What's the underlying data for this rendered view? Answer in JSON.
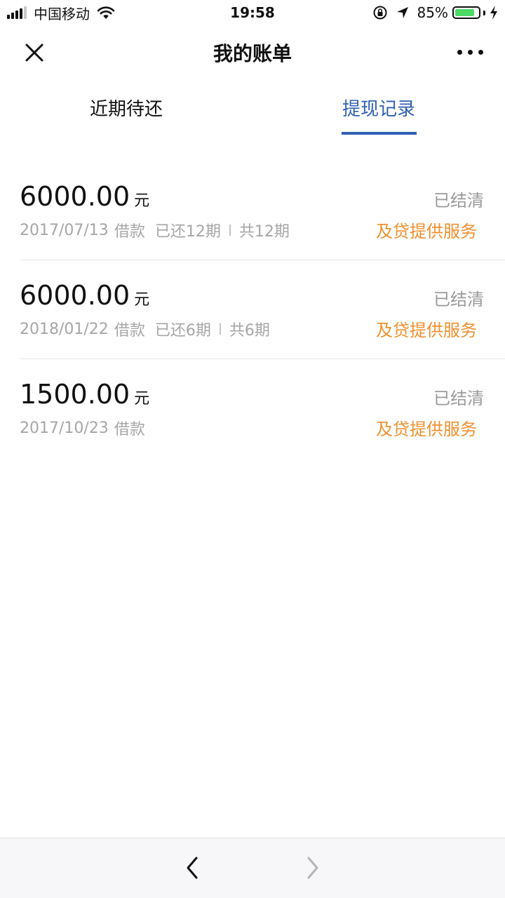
{
  "status_bar": {
    "carrier": "中国移动",
    "time": "19:58",
    "battery_percent": "85%",
    "battery_level": 0.85,
    "signal_bars": 4,
    "icons": [
      "signal-icon",
      "wifi-icon",
      "orientation-lock-icon",
      "location-arrow-icon",
      "battery-icon",
      "charging-bolt-icon"
    ]
  },
  "nav": {
    "title": "我的账单",
    "close_icon": "close-icon",
    "more_icon": "more-dots-icon"
  },
  "tabs": [
    {
      "label": "近期待还",
      "active": false
    },
    {
      "label": "提现记录",
      "active": true
    }
  ],
  "records": [
    {
      "amount": "6000.00",
      "unit": "元",
      "status": "已结清",
      "date": "2017/07/13",
      "type": "借款",
      "paid": "已还12期",
      "total": "共12期",
      "provider": "及贷提供服务"
    },
    {
      "amount": "6000.00",
      "unit": "元",
      "status": "已结清",
      "date": "2018/01/22",
      "type": "借款",
      "paid": "已还6期",
      "total": "共6期",
      "provider": "及贷提供服务"
    },
    {
      "amount": "1500.00",
      "unit": "元",
      "status": "已结清",
      "date": "2017/10/23",
      "type": "借款",
      "provider": "及贷提供服务"
    }
  ],
  "toolbar": {
    "back_icon": "chevron-left-icon",
    "forward_icon": "chevron-right-icon",
    "forward_enabled": false
  },
  "colors": {
    "accent_blue": "#2f5fb3",
    "provider_orange": "#f0902e",
    "muted_gray": "#a6a6a6",
    "battery_green": "#4cd964"
  }
}
